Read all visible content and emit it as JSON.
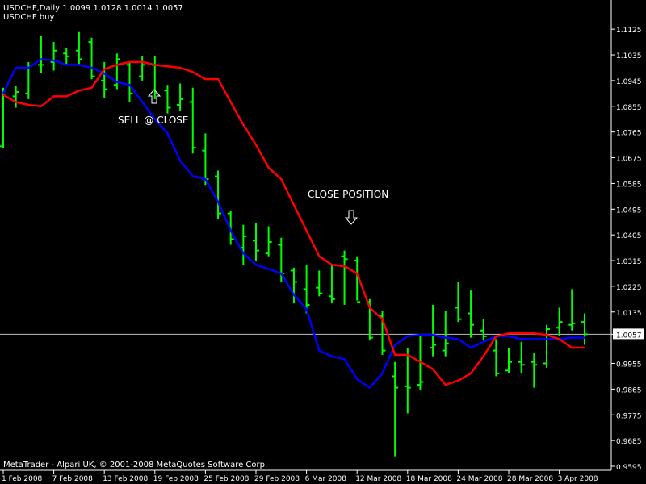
{
  "header": {
    "line1": "USDCHF,Daily  1.0099 1.0128 1.0014 1.0057",
    "line2": "USDCHF buy"
  },
  "footer": {
    "copyright": "MetaTrader - Alpari UK, © 2001-2008 MetaQuotes Software Corp."
  },
  "annotations": {
    "sell_text": "SELL @ CLOSE",
    "close_text": "CLOSE POSITION"
  },
  "colors": {
    "background": "#000000",
    "axis": "#ffffff",
    "bars": "#00ff00",
    "fast_line": "#0000ff",
    "slow_line": "#ff0000",
    "price_line": "#c0c0c0"
  },
  "chart_data": {
    "type": "ohlc",
    "title": "USDCHF,Daily",
    "ylim": [
      0.9595,
      1.1165
    ],
    "y_ticks": [
      "1.1125",
      "1.1035",
      "1.0945",
      "1.0855",
      "1.0765",
      "1.0675",
      "1.0585",
      "1.0495",
      "1.0405",
      "1.0315",
      "1.0225",
      "1.0135",
      "1.0057",
      "0.9955",
      "0.9865",
      "0.9775",
      "0.9685",
      "0.9595"
    ],
    "x_tick_labels": [
      "1 Feb 2008",
      "7 Feb 2008",
      "13 Feb 2008",
      "19 Feb 2008",
      "25 Feb 2008",
      "29 Feb 2008",
      "6 Mar 2008",
      "12 Mar 2008",
      "18 Mar 2008",
      "24 Mar 2008",
      "28 Mar 2008",
      "3 Apr 2008"
    ],
    "x_tick_index": [
      0,
      4,
      8,
      12,
      16,
      20,
      24,
      28,
      32,
      36,
      40,
      44
    ],
    "current_price": "1.0057",
    "ohlc": [
      [
        1.0715,
        1.092,
        1.071,
        1.091
      ],
      [
        1.089,
        1.0925,
        1.085,
        1.0905
      ],
      [
        1.09,
        1.101,
        1.088,
        1.0995
      ],
      [
        1.1,
        1.11,
        1.097,
        1.1
      ],
      [
        1.101,
        1.108,
        1.098,
        1.105
      ],
      [
        1.104,
        1.106,
        1.1,
        1.103
      ],
      [
        1.105,
        1.1115,
        1.1,
        1.102
      ],
      [
        1.108,
        1.1095,
        1.095,
        1.096
      ],
      [
        1.0945,
        1.101,
        1.0885,
        1.0915
      ],
      [
        1.093,
        1.104,
        1.0915,
        1.102
      ],
      [
        1.1,
        1.101,
        1.087,
        1.09
      ],
      [
        1.096,
        1.103,
        1.0945,
        1.1
      ],
      [
        1.1,
        1.103,
        1.088,
        1.09
      ],
      [
        1.091,
        1.093,
        1.083,
        1.085
      ],
      [
        1.086,
        1.0935,
        1.084,
        1.088
      ],
      [
        1.087,
        1.092,
        1.069,
        1.071
      ],
      [
        1.07,
        1.076,
        1.058,
        1.06
      ],
      [
        1.061,
        1.063,
        1.046,
        1.048
      ],
      [
        1.048,
        1.049,
        1.037,
        1.039
      ],
      [
        1.036,
        1.044,
        1.03,
        1.04
      ],
      [
        1.0385,
        1.0445,
        1.0315,
        1.035
      ],
      [
        1.034,
        1.0435,
        1.033,
        1.038
      ],
      [
        1.037,
        1.0395,
        1.024,
        1.027
      ],
      [
        1.028,
        1.029,
        1.0165,
        1.024
      ],
      [
        1.0215,
        1.03,
        1.013,
        1.016
      ],
      [
        1.022,
        1.028,
        1.019,
        1.02
      ],
      [
        1.019,
        1.03,
        1.0165,
        1.018
      ],
      [
        1.033,
        1.035,
        1.016,
        1.032
      ],
      [
        1.0315,
        1.033,
        1.0175,
        1.017
      ],
      [
        1.017,
        1.018,
        1.0035,
        1.0045
      ],
      [
        1.012,
        1.014,
        0.9985,
        1.0
      ],
      [
        0.991,
        0.996,
        0.963,
        0.987
      ],
      [
        0.9875,
        1.001,
        0.978,
        0.987
      ],
      [
        0.988,
        1.005,
        0.986,
        0.989
      ],
      [
        1.001,
        1.016,
        0.998,
        1.002
      ],
      [
        1.0,
        1.014,
        0.998,
        1.0025
      ],
      [
        1.015,
        1.024,
        1.01,
        1.011
      ],
      [
        1.013,
        1.021,
        1.0045,
        1.009
      ],
      [
        1.007,
        1.011,
        1.0035,
        1.005
      ],
      [
        1.0,
        1.004,
        0.991,
        0.992
      ],
      [
        0.993,
        1.001,
        0.992,
        0.996
      ],
      [
        0.996,
        1.003,
        0.992,
        0.995
      ],
      [
        0.996,
        0.999,
        0.987,
        0.995
      ],
      [
        0.9955,
        1.009,
        0.994,
        1.0075
      ],
      [
        1.008,
        1.015,
        1.005,
        1.01
      ],
      [
        1.009,
        1.0215,
        1.007,
        1.0095
      ],
      [
        1.01,
        1.013,
        1.002,
        1.0057
      ]
    ],
    "blue_line": [
      [
        0,
        1.09
      ],
      [
        1,
        1.099
      ],
      [
        2,
        1.099
      ],
      [
        3,
        1.102
      ],
      [
        4,
        1.1015
      ],
      [
        5,
        1.1
      ],
      [
        6,
        1.1
      ],
      [
        7,
        1.099
      ],
      [
        8,
        1.097
      ],
      [
        9,
        1.094
      ],
      [
        10,
        1.093
      ],
      [
        11,
        1.087
      ],
      [
        12,
        1.081
      ],
      [
        13,
        1.076
      ],
      [
        14,
        1.0665
      ],
      [
        15,
        1.061
      ],
      [
        16,
        1.06
      ],
      [
        17,
        1.052
      ],
      [
        18,
        1.042
      ],
      [
        19,
        1.034
      ],
      [
        20,
        1.03
      ],
      [
        21,
        1.0285
      ],
      [
        22,
        1.027
      ],
      [
        23,
        1.0195
      ],
      [
        24,
        1.0145
      ],
      [
        25,
        1.0
      ],
      [
        26,
        0.998
      ],
      [
        27,
        0.997
      ],
      [
        28,
        0.99
      ],
      [
        29,
        0.987
      ],
      [
        30,
        0.992
      ],
      [
        31,
        1.002
      ],
      [
        32,
        1.005
      ],
      [
        33,
        1.0055
      ],
      [
        34,
        1.0055
      ],
      [
        35,
        1.0045
      ],
      [
        36,
        1.004
      ],
      [
        37,
        1.001
      ],
      [
        38,
        1.003
      ],
      [
        39,
        1.005
      ],
      [
        40,
        1.005
      ],
      [
        41,
        1.004
      ],
      [
        42,
        1.004
      ],
      [
        43,
        1.004
      ],
      [
        44,
        1.004
      ],
      [
        45,
        1.0045
      ],
      [
        46,
        1.0045
      ]
    ],
    "red_line": [
      [
        0,
        1.0895
      ],
      [
        1,
        1.087
      ],
      [
        2,
        1.086
      ],
      [
        3,
        1.0855
      ],
      [
        4,
        1.089
      ],
      [
        5,
        1.089
      ],
      [
        6,
        1.091
      ],
      [
        7,
        1.092
      ],
      [
        8,
        1.0985
      ],
      [
        9,
        1.1
      ],
      [
        10,
        1.101
      ],
      [
        11,
        1.101
      ],
      [
        12,
        1.1
      ],
      [
        13,
        1.0995
      ],
      [
        14,
        1.099
      ],
      [
        15,
        1.0975
      ],
      [
        16,
        1.095
      ],
      [
        17,
        1.095
      ],
      [
        18,
        1.087
      ],
      [
        19,
        1.079
      ],
      [
        20,
        1.072
      ],
      [
        21,
        1.064
      ],
      [
        22,
        1.06
      ],
      [
        23,
        1.051
      ],
      [
        24,
        1.042
      ],
      [
        25,
        1.033
      ],
      [
        26,
        1.03
      ],
      [
        27,
        1.0295
      ],
      [
        28,
        1.027
      ],
      [
        29,
        1.015
      ],
      [
        30,
        1.011
      ],
      [
        31,
        0.9985
      ],
      [
        32,
        0.9985
      ],
      [
        33,
        0.996
      ],
      [
        34,
        0.9935
      ],
      [
        35,
        0.988
      ],
      [
        36,
        0.9895
      ],
      [
        37,
        0.992
      ],
      [
        38,
        0.998
      ],
      [
        39,
        1.005
      ],
      [
        40,
        1.006
      ],
      [
        41,
        1.006
      ],
      [
        42,
        1.006
      ],
      [
        43,
        1.0055
      ],
      [
        44,
        1.004
      ],
      [
        45,
        1.001
      ],
      [
        46,
        1.001
      ]
    ]
  }
}
